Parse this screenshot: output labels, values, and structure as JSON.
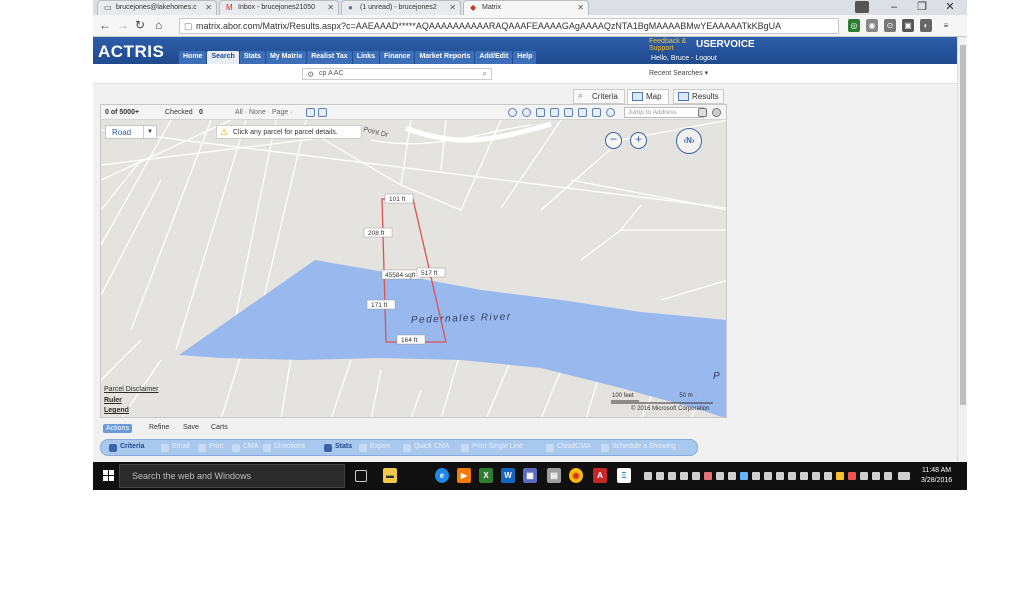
{
  "browser": {
    "tabs": [
      {
        "label": "brucejones@lakehomes.c"
      },
      {
        "label": "Inbox - brucejones21050"
      },
      {
        "label": "(1 unread) - brucejones2"
      },
      {
        "label": "Matrix"
      }
    ],
    "url": "matrix.abor.com/Matrix/Results.aspx?c=AAEAAAD*****AQAAAAAAAAAARAQAAAFEAAAAGAgAAAAQzNTA1BgMAAAABMwYEAAAAATkKBgUA"
  },
  "app": {
    "logo": "ACTRIS",
    "nav": [
      "Home",
      "Search",
      "Stats",
      "My Matrix",
      "Realist Tax",
      "Links",
      "Finance",
      "Market Reports",
      "Add/Edit",
      "Help"
    ],
    "active_nav": "Search",
    "feedback": "Feedback & Support",
    "uservoice": "USERVOICE",
    "greeting": "Hello, Bruce - Logout",
    "quick_search": "cp A AC",
    "recent_searches": "Recent Searches"
  },
  "views": {
    "criteria": "Criteria",
    "map": "Map",
    "results": "Results"
  },
  "map": {
    "count": "0 of 5000+",
    "checked_label": "Checked",
    "checked_value": "0",
    "select_opts": "All · None · Page ·",
    "jump_placeholder": "Jump to Address",
    "road_select": "Road",
    "tip": "Click any parcel for parcel details.",
    "street_label": "Point Dr",
    "river_label": "Pedernales River",
    "river_label_edge": "P",
    "measurements": {
      "top": "101 ft",
      "left_upper": "208 ft",
      "area": "45584 sqft",
      "right": "517 ft",
      "left_lower": "171 ft",
      "bottom": "164 ft"
    },
    "links": [
      "Parcel Disclaimer",
      "Ruler",
      "Legend"
    ],
    "scale_feet": "100 feet",
    "scale_m": "50 m",
    "copyright": "© 2016 Microsoft Corporation"
  },
  "actions": {
    "tabs": [
      "Actions",
      "Refine",
      "Save",
      "Carts"
    ],
    "bottom": [
      "Criteria",
      "Email",
      "Print",
      "CMA",
      "Directions",
      "Stats",
      "Export",
      "Quick CMA",
      "Print Single Line",
      "CloudCMA",
      "Schedule a Showing"
    ]
  },
  "taskbar": {
    "search": "Search the web and Windows",
    "time": "11:48 AM",
    "date": "3/28/2016"
  },
  "colors": {
    "brand_blue": "#1f4a8e",
    "river": "#8fb3ef",
    "parcel": "#d9534f"
  }
}
